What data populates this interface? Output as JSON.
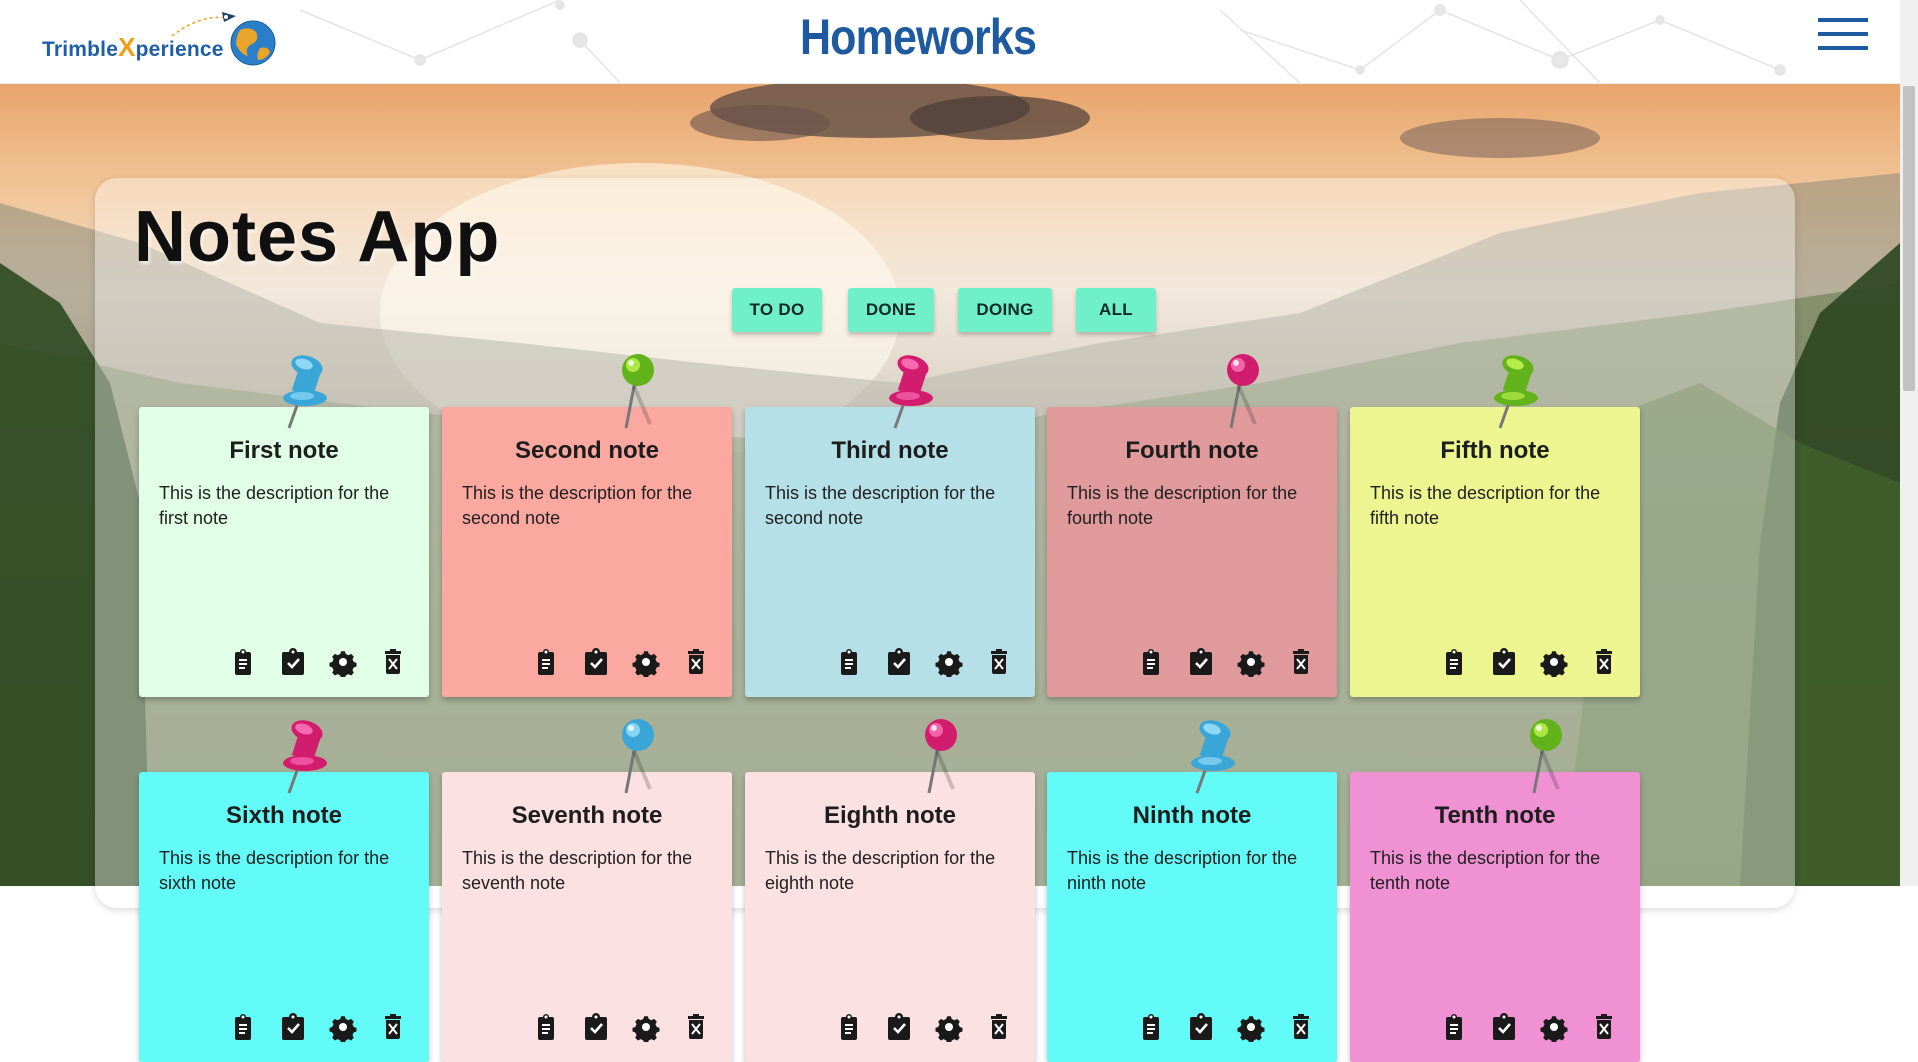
{
  "header": {
    "logo_left": "Trimble",
    "logo_x": "X",
    "logo_right": "perience",
    "title": "Homeworks"
  },
  "app": {
    "title": "Notes App"
  },
  "filters": [
    {
      "label": "TO DO"
    },
    {
      "label": "DONE"
    },
    {
      "label": "DOING"
    },
    {
      "label": "ALL"
    }
  ],
  "notes": [
    {
      "title": "First note",
      "description": "This is the description for the first note",
      "color": "#e1ffe6",
      "pin": "blue-pushpin"
    },
    {
      "title": "Second note",
      "description": "This is the description for the second note",
      "color": "#fba8a1",
      "pin": "green-needle"
    },
    {
      "title": "Third note",
      "description": "This is the description for the second note",
      "color": "#b6e0e8",
      "pin": "pink-pushpin"
    },
    {
      "title": "Fourth note",
      "description": "This is the description for the fourth note",
      "color": "#e19a9b",
      "pin": "pink-needle"
    },
    {
      "title": "Fifth note",
      "description": "This is the description for the fifth note",
      "color": "#edf591",
      "pin": "green-pushpin"
    },
    {
      "title": "Sixth note",
      "description": "This is the description for the sixth note",
      "color": "#63fbf8",
      "pin": "pink-pushpin"
    },
    {
      "title": "Seventh note",
      "description": "This is the description for the seventh note",
      "color": "#fbe1e1",
      "pin": "blue-needle"
    },
    {
      "title": "Eighth note",
      "description": "This is the description for the eighth note",
      "color": "#fbe1e1",
      "pin": "pink-needle"
    },
    {
      "title": "Ninth note",
      "description": "This is the description for the ninth note",
      "color": "#63fbf8",
      "pin": "blue-pushpin"
    },
    {
      "title": "Tenth note",
      "description": "This is the description for the tenth note",
      "color": "#ef91d2",
      "pin": "green-needle"
    }
  ],
  "note_actions": [
    "clipboard-icon",
    "check-clipboard-icon",
    "gear-icon",
    "delete-icon"
  ],
  "colors": {
    "brand_blue": "#1e5aa0",
    "filter_button": "#6ff0c8"
  }
}
